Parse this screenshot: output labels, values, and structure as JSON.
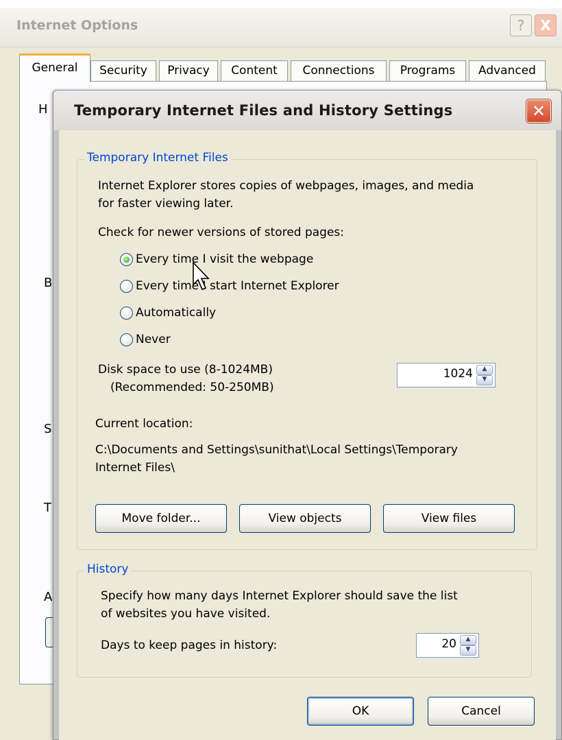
{
  "background_window": {
    "title": "Internet Options",
    "help_button": "?",
    "close_button": "X",
    "tabs": [
      {
        "label": "General",
        "active": true
      },
      {
        "label": "Security"
      },
      {
        "label": "Privacy"
      },
      {
        "label": "Content"
      },
      {
        "label": "Connections"
      },
      {
        "label": "Programs"
      },
      {
        "label": "Advanced"
      }
    ],
    "obscured_letters": [
      "H",
      "B",
      "S",
      "T",
      "A"
    ]
  },
  "dialog": {
    "title": "Temporary Internet Files and History Settings",
    "close_glyph": "✕",
    "temp_files": {
      "legend": "Temporary Internet Files",
      "description_line1": "Internet Explorer stores copies of webpages, images, and media",
      "description_line2": "for faster viewing later.",
      "check_label": "Check for newer versions of stored pages:",
      "options": [
        {
          "label": "Every time I visit the webpage",
          "selected": true
        },
        {
          "label": "Every time I start Internet Explorer",
          "selected": false
        },
        {
          "label": "Automatically",
          "selected": false
        },
        {
          "label": "Never",
          "selected": false
        }
      ],
      "disk_label": "Disk space to use (8-1024MB)",
      "disk_recommended": "(Recommended: 50-250MB)",
      "disk_value": "1024",
      "location_label": "Current location:",
      "location_line1": "C:\\Documents and Settings\\sunithat\\Local Settings\\Temporary",
      "location_line2": "Internet Files\\",
      "buttons": {
        "move_folder": "Move folder...",
        "view_objects": "View objects",
        "view_files": "View files"
      }
    },
    "history": {
      "legend": "History",
      "description_line1": "Specify how many days Internet Explorer should save the list",
      "description_line2": "of websites you have visited.",
      "days_label": "Days to keep pages in history:",
      "days_value": "20"
    },
    "ok": "OK",
    "cancel": "Cancel"
  },
  "colors": {
    "legend_blue": "#0046d5",
    "close_red": "#d24a2a",
    "face": "#ece9d8",
    "radio_selected": "#21a121"
  }
}
